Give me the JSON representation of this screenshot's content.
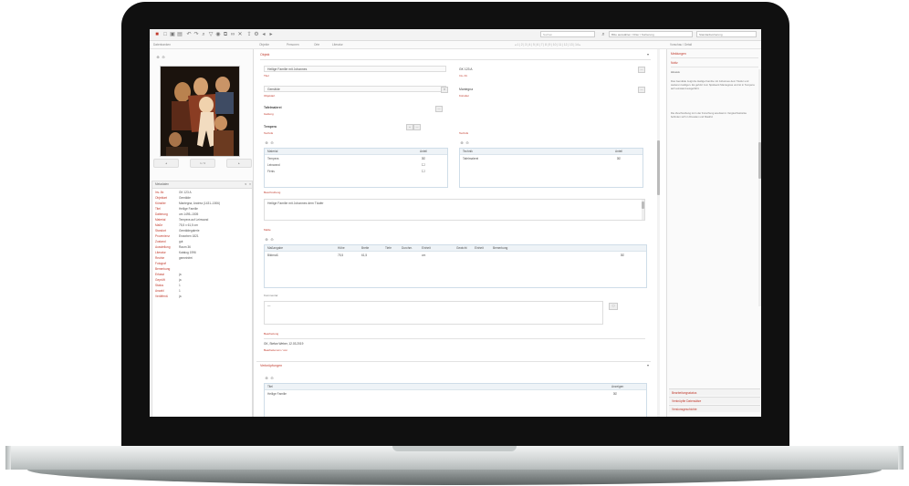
{
  "toolbar": {
    "search_placeholder": "Suchen",
    "select_one": "Bitte auswählen / Filter / Sortierung",
    "select_two": "Standardsortierung",
    "right_label": "Vorschau / Detail"
  },
  "tabs": [
    "Datenbanken",
    "Objekte",
    "Personen",
    "Orte",
    "Literatur"
  ],
  "left": {
    "tree_title": "Metadaten",
    "tree_rows": [
      {
        "k": "Inv.-Nr.",
        "v": "GK 123 A"
      },
      {
        "k": "Objektart",
        "v": "Gemälde"
      },
      {
        "k": "Künstler",
        "v": "Mantegna, Andrea (1431–1506)"
      },
      {
        "k": "Titel",
        "v": "Heilige Familie"
      },
      {
        "k": "Datierung",
        "v": "um 1495–1505"
      },
      {
        "k": "Material",
        "v": "Tempera auf Leinwand"
      },
      {
        "k": "Maße",
        "v": "75,5 x 61,5 cm"
      },
      {
        "k": "Standort",
        "v": "Gemäldegalerie"
      },
      {
        "k": "Provenienz",
        "v": "Erworben 1821"
      },
      {
        "k": "Zustand",
        "v": "gut"
      },
      {
        "k": "Ausstellung",
        "v": "Raum 36"
      },
      {
        "k": "Literatur",
        "v": "Katalog 1996"
      },
      {
        "k": "Rechte",
        "v": "gemeinfrei"
      },
      {
        "k": "Fotograf",
        "v": ""
      },
      {
        "k": "Bemerkung",
        "v": ""
      },
      {
        "k": "Erfasst",
        "v": "ja"
      },
      {
        "k": "Geprüft",
        "v": "ja"
      },
      {
        "k": "Status",
        "v": "1"
      },
      {
        "k": "Anzahl",
        "v": "1"
      },
      {
        "k": "Veröffentl.",
        "v": "ja"
      }
    ]
  },
  "main": {
    "section_title": "Objekt",
    "field_1": "Heilige Familie mit Johannes",
    "field_1_label": "Titel",
    "field_1b": "GK 123 A",
    "field_1b_label": "Inv.-Nr.",
    "field_2": "Gemälde",
    "field_2_label": "Objektart",
    "field_2b": "Mantegna",
    "field_2b_label": "Künstler",
    "field_3": "Tafelmalerei",
    "field_3_label": "Gattung",
    "field_4": "Tempera",
    "field_4_label": "Technik",
    "list_left_title": "Material",
    "list_left_col": "Anteil",
    "list_left_rows": [
      "Tempera",
      "Leinwand",
      "Firnis"
    ],
    "list_right_title": "Technik",
    "list_right_col": "Anteil",
    "list_right_rows": [
      "Tafelmalerei"
    ],
    "notes_label": "Beschreibung",
    "notes_text": "Heilige Familie mit Johannes dem Täufer",
    "dim_label": "Maße",
    "dim_headers": [
      "Maßangabe",
      "Höhe",
      "Breite",
      "Tiefe",
      "Durchm.",
      "Einheit",
      "Gewicht",
      "Einheit",
      "Bemerkung"
    ],
    "dim_row": [
      "Bildmaß",
      "75,5",
      "61,5",
      "",
      "",
      "cm",
      "",
      "",
      ""
    ],
    "comment_label": "Kommentar",
    "comment_text": "—",
    "edit_label": "Bearbeitung",
    "edit_text": "GK, Stefan Weber, 12.03.2019",
    "edit_sub": "Bearbeitet am / von",
    "sub_section": "Verknüpfungen",
    "link_header": "Titel",
    "link_col": "Anzeigen",
    "link_row": "Heilige Familie"
  },
  "right": {
    "head1": "Meldungen",
    "head2": "Notiz",
    "sub": "Hinweis",
    "paragraph1": "Das Gemälde zeigt die Heilige Familie mit Johannes dem Täufer und weiteren Heiligen. Es gehört zum Spätwerk Mantegnas und ist in Tempera auf Leinwand ausgeführt.",
    "paragraph2": "Die Zuschreibung ist in der Forschung anerkannt. Vergleichsstücke befinden sich in Dresden und Madrid.",
    "foot1": "Bearbeitungsstatus",
    "foot2": "Verknüpfte Datensätze",
    "foot3": "Versionsgeschichte"
  }
}
